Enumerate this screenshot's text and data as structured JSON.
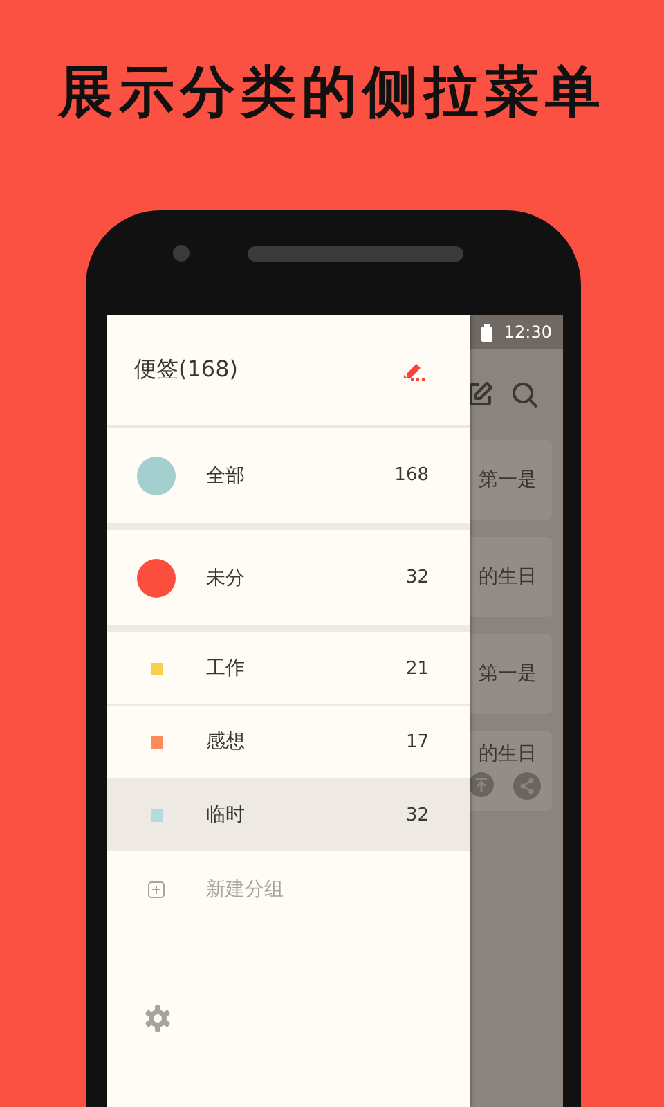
{
  "headline": "展示分类的侧拉菜单",
  "status_bar": {
    "time": "12:30"
  },
  "notes": [
    {
      "text": "第一是",
      "actions": false
    },
    {
      "text": "的生日",
      "actions": false
    },
    {
      "text": "第一是",
      "actions": false
    },
    {
      "text": "的生日",
      "actions": true
    }
  ],
  "drawer": {
    "title": "便签(168)",
    "groups": [
      {
        "kind": "circle",
        "label": "全部",
        "count": "168",
        "color": "#a5cfcf",
        "selected": false,
        "separator": true
      },
      {
        "kind": "circle",
        "label": "未分",
        "count": "32",
        "color": "#fb4e3d",
        "selected": false,
        "separator": true
      },
      {
        "kind": "square",
        "label": "工作",
        "count": "21",
        "color": "#f8ce4c",
        "selected": false,
        "separator": false
      },
      {
        "kind": "square",
        "label": "感想",
        "count": "17",
        "color": "#ff8b5c",
        "selected": false,
        "separator": false
      },
      {
        "kind": "square",
        "label": "临时",
        "count": "32",
        "color": "#b5dcdc",
        "selected": true,
        "separator": false
      }
    ],
    "new_group": "新建分组"
  }
}
